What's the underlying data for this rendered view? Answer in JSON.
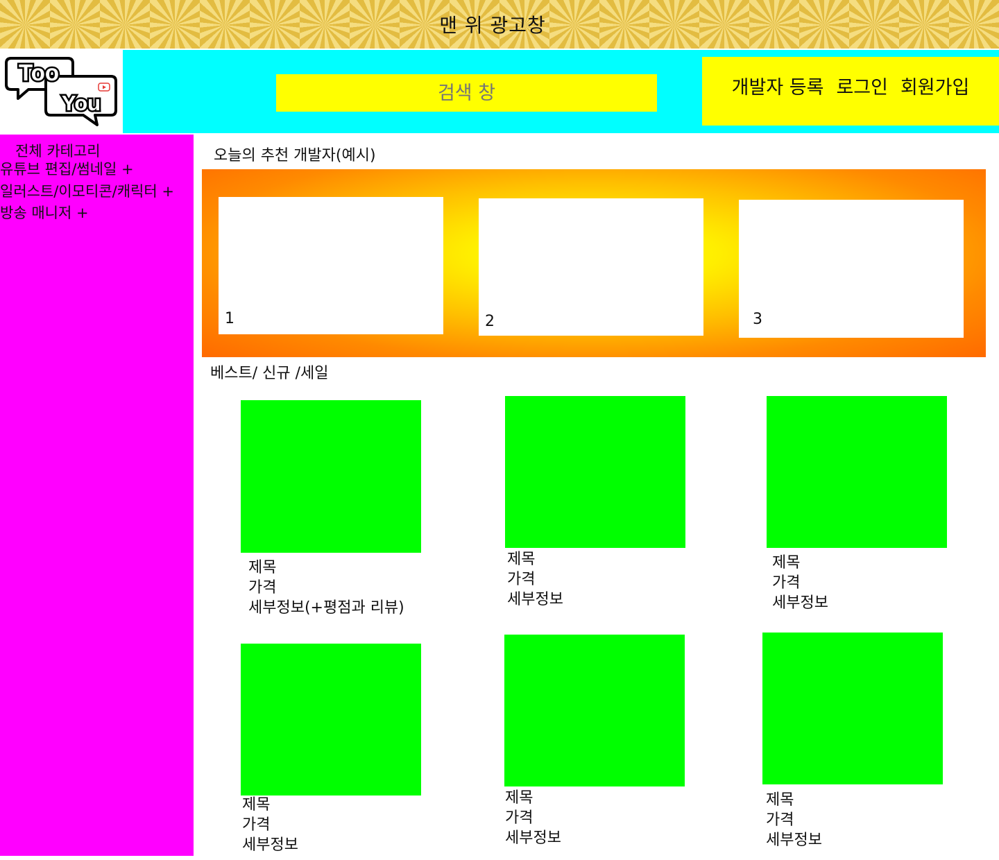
{
  "ad_banner": {
    "text": "맨 위 광고창"
  },
  "logo": {
    "line1": "Too",
    "line2": "You"
  },
  "search": {
    "label": "검색 창"
  },
  "auth": {
    "developer_register": "개발자 등록",
    "login": "로그인",
    "signup": "회원가입"
  },
  "sidebar": {
    "title": "전체 카테고리",
    "items": [
      {
        "label": "유튜브 편집/썸네일   +"
      },
      {
        "label": "일러스트/이모티콘/캐릭터 +"
      },
      {
        "label": "방송 매니저 +"
      }
    ]
  },
  "recommended": {
    "title": "오늘의 추천 개발자(예시)",
    "cards": [
      {
        "num": "1"
      },
      {
        "num": "2"
      },
      {
        "num": "3"
      }
    ]
  },
  "best": {
    "title": "베스트/ 신규 /세일",
    "products": [
      {
        "title": "제목",
        "price": "가격",
        "detail": "세부정보(+평점과 리뷰)"
      },
      {
        "title": "제목",
        "price": "가격",
        "detail": "세부정보"
      },
      {
        "title": "제목",
        "price": "가격",
        "detail": "세부정보"
      },
      {
        "title": "제목",
        "price": "가격",
        "detail": "세부정보"
      },
      {
        "title": "제목",
        "price": "가격",
        "detail": "세부정보"
      },
      {
        "title": "제목",
        "price": "가격",
        "detail": "세부정보"
      }
    ]
  },
  "colors": {
    "header_bar": "#00ffff",
    "highlight": "#ffff00",
    "sidebar": "#ff00ff",
    "product_image": "#00ff00",
    "reco_outer": "#ff6a00",
    "youtube_red": "#e53935"
  }
}
